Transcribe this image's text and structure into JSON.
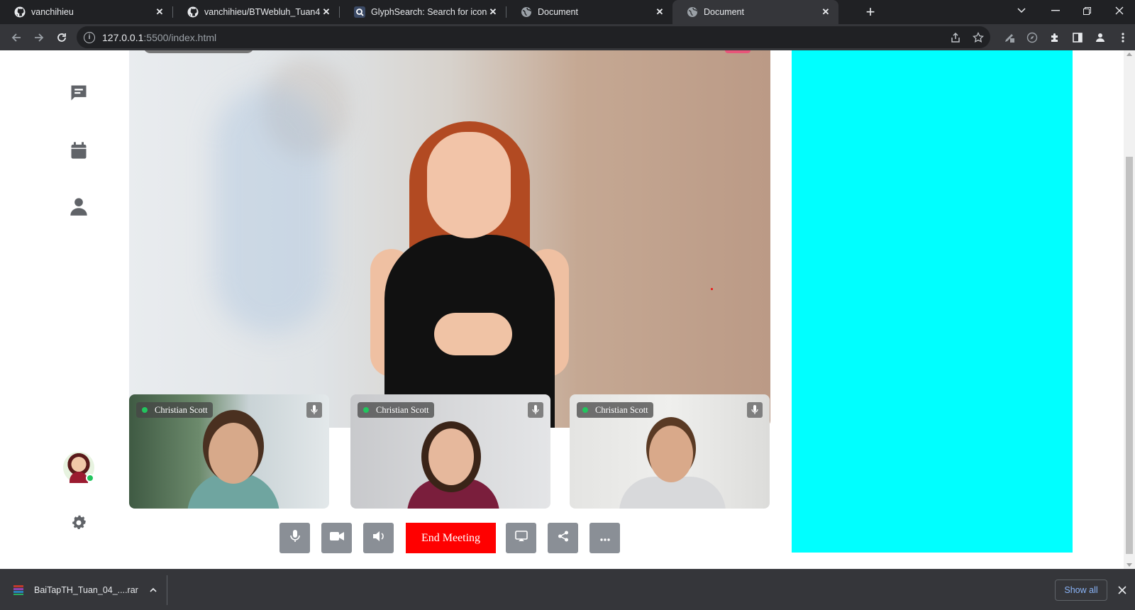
{
  "browser": {
    "tabs": [
      {
        "label": "vanchihieu",
        "icon": "github-icon"
      },
      {
        "label": "vanchihieu/BTWebluh_Tuan4",
        "icon": "github-icon"
      },
      {
        "label": "GlyphSearch: Search for icons fro",
        "icon": "glyphsearch-icon"
      },
      {
        "label": "Document",
        "icon": "globe-icon"
      },
      {
        "label": "Document",
        "icon": "globe-icon",
        "active": true
      }
    ],
    "url_host": "127.0.0.1",
    "url_rest": ":5500/index.html"
  },
  "sidebar": {
    "items": [
      {
        "name": "chat-icon"
      },
      {
        "name": "calendar-icon"
      },
      {
        "name": "user-icon"
      }
    ],
    "settings_icon": "gear-icon"
  },
  "participants": [
    {
      "name": "Christian Scott",
      "status": "online",
      "mic_icon": "microphone-icon"
    },
    {
      "name": "Christian Scott",
      "status": "online",
      "mic_icon": "microphone-icon"
    },
    {
      "name": "Christian Scott",
      "status": "online",
      "mic_icon": "microphone-icon"
    }
  ],
  "controls": {
    "mic": "microphone-icon",
    "camera": "video-camera-icon",
    "speaker": "speaker-icon",
    "end_meeting_label": "End Meeting",
    "screen": "cast-screen-icon",
    "share": "share-icon",
    "more": "more-icon"
  },
  "colors": {
    "end_meeting": "#ff0000",
    "right_panel": "#00ffff",
    "online": "#22c55e",
    "control_bg": "#8a8f96"
  },
  "downloads": {
    "file_name": "BaiTapTH_Tuan_04_....rar",
    "show_all_label": "Show all"
  }
}
